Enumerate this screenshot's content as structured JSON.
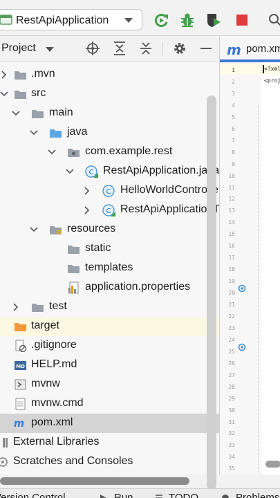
{
  "toolbar": {
    "run_config": "RestApiApplication",
    "buttons": [
      "rerun-icon",
      "debug-icon",
      "coverage-icon",
      "stop-icon"
    ],
    "colors": {
      "run": "#43a047",
      "stop": "#e23b3b"
    }
  },
  "project_panel": {
    "title": "Project",
    "tree": [
      {
        "label": ".mvn",
        "icon": "folder-icon"
      },
      {
        "label": "src",
        "icon": "folder-icon"
      },
      {
        "label": "main",
        "icon": "folder-icon"
      },
      {
        "label": "java",
        "icon": "source-folder-icon"
      },
      {
        "label": "com.example.rest",
        "icon": "package-icon"
      },
      {
        "label": "RestApiApplication.java",
        "icon": "class-icon"
      },
      {
        "label": "HelloWorldController",
        "icon": "class-icon"
      },
      {
        "label": "RestApiApplicationTests",
        "icon": "class-icon"
      },
      {
        "label": "resources",
        "icon": "resources-folder-icon"
      },
      {
        "label": "static",
        "icon": "folder-icon"
      },
      {
        "label": "templates",
        "icon": "folder-icon"
      },
      {
        "label": "application.properties",
        "icon": "properties-icon"
      },
      {
        "label": "test",
        "icon": "folder-icon"
      },
      {
        "label": "target",
        "icon": "excluded-folder-icon"
      },
      {
        "label": ".gitignore",
        "icon": "gitignore-icon"
      },
      {
        "label": "HELP.md",
        "icon": "markdown-icon"
      },
      {
        "label": "mvnw",
        "icon": "shell-icon"
      },
      {
        "label": "mvnw.cmd",
        "icon": "file-icon"
      },
      {
        "label": "pom.xml",
        "icon": "maven-icon"
      },
      {
        "label": "External Libraries",
        "icon": "libraries-icon"
      },
      {
        "label": "Scratches and Consoles",
        "icon": "scratches-icon"
      }
    ]
  },
  "editor": {
    "tab_label": "pom.xml",
    "line_numbers": [
      "1",
      "2",
      "3",
      "4",
      "5",
      "6",
      "7",
      "8",
      "9",
      "10",
      "11",
      "12",
      "13",
      "14",
      "15",
      "16",
      "17",
      "18",
      "19",
      "20",
      "21",
      "22",
      "23",
      "24",
      "25",
      "26",
      "27",
      "28",
      "29",
      "30",
      "31",
      "32",
      "33",
      "34",
      "35"
    ],
    "code_lines": [
      "<?xml",
      "<proje"
    ]
  },
  "bottom_bar": {
    "items": [
      "Version Control",
      "Run",
      "TODO",
      "Problems"
    ]
  }
}
